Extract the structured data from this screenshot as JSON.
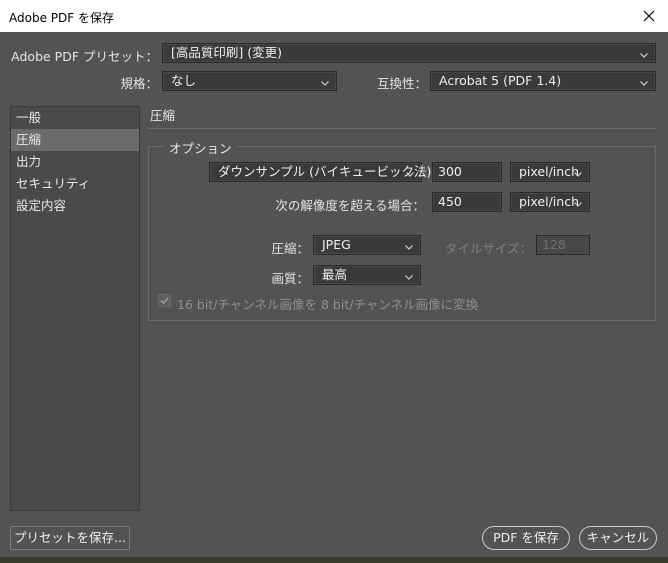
{
  "window": {
    "title": "Adobe PDF を保存",
    "close_icon": "close-icon"
  },
  "preset": {
    "label": "Adobe PDF プリセット：",
    "value": "[高品質印刷] (変更)"
  },
  "standard": {
    "label": "規格：",
    "value": "なし"
  },
  "compatibility": {
    "label": "互換性：",
    "value": "Acrobat 5 (PDF 1.4)"
  },
  "sidebar": {
    "items": [
      {
        "label": "一般",
        "selected": false
      },
      {
        "label": "圧縮",
        "selected": true
      },
      {
        "label": "出力",
        "selected": false
      },
      {
        "label": "セキュリティ",
        "selected": false
      },
      {
        "label": "設定内容",
        "selected": false
      }
    ]
  },
  "main": {
    "section_title": "圧縮",
    "options_legend": "オプション",
    "downsample": {
      "method": "ダウンサンプル (バイキュービック法)",
      "resolution": "300",
      "unit": "pixel/inch"
    },
    "threshold": {
      "label": "次の解像度を超える場合：",
      "value": "450",
      "unit": "pixel/inch"
    },
    "compression": {
      "label": "圧縮：",
      "value": "JPEG"
    },
    "tile_size": {
      "label": "タイルサイズ：",
      "value": "128"
    },
    "quality": {
      "label": "画質：",
      "value": "最高"
    },
    "convert_16bit": {
      "label": "16 bit/チャンネル画像を 8 bit/チャンネル画像に変換",
      "checked": true
    }
  },
  "footer": {
    "save_preset_label": "プリセットを保存...",
    "save_pdf_label": "PDF を保存",
    "cancel_label": "キャンセル"
  },
  "colors": {
    "background": "#535353",
    "field": "#3a3a3a",
    "selected_item": "#6b6b6b"
  }
}
